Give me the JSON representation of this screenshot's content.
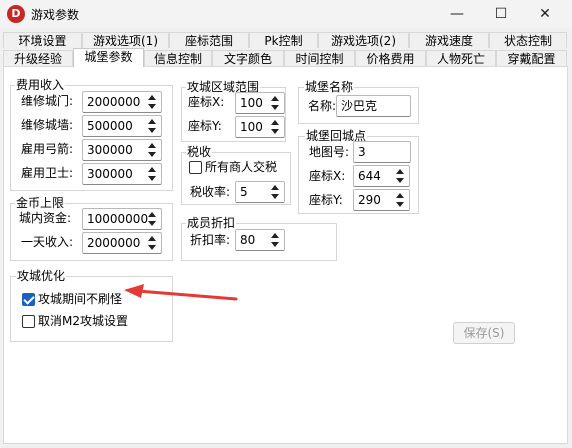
{
  "window": {
    "title": "游戏参数",
    "app_icon_letter": "D",
    "minimize_glyph": "—",
    "maximize_glyph": "☐",
    "close_glyph": "✕"
  },
  "tabs_row1": [
    "环境设置",
    "游戏选项(1)",
    "座标范围",
    "Pk控制",
    "游戏选项(2)",
    "游戏速度",
    "状态控制"
  ],
  "tabs_row2": [
    "升级经验",
    "城堡参数",
    "信息控制",
    "文字颜色",
    "时间控制",
    "价格费用",
    "人物死亡",
    "穿戴配置"
  ],
  "active_tab": "城堡参数",
  "fees": {
    "title": "费用收入",
    "fields": [
      {
        "label": "维修城门:",
        "value": "2000000"
      },
      {
        "label": "维修城墙:",
        "value": "500000"
      },
      {
        "label": "雇用弓箭:",
        "value": "300000"
      },
      {
        "label": "雇用卫士:",
        "value": "300000"
      }
    ]
  },
  "gold_limit": {
    "title": "金币上限",
    "fields": [
      {
        "label": "城内资金:",
        "value": "10000000"
      },
      {
        "label": "一天收入:",
        "value": "2000000"
      }
    ]
  },
  "siege_opt": {
    "title": "攻城优化",
    "options": [
      {
        "label": "攻城期间不刷怪",
        "checked": true
      },
      {
        "label": "取消M2攻城设置",
        "checked": false
      }
    ]
  },
  "siege_area": {
    "title": "攻城区域范围",
    "fields": [
      {
        "label": "座标X:",
        "value": "100"
      },
      {
        "label": "座标Y:",
        "value": "100"
      }
    ]
  },
  "tax": {
    "title": "税收",
    "all_merchants_label": "所有商人交税",
    "all_merchants_checked": false,
    "rate_label": "税收率:",
    "rate_value": "5"
  },
  "member_discount": {
    "title": "成员折扣",
    "label": "折扣率:",
    "value": "80"
  },
  "castle_name": {
    "title": "城堡名称",
    "label": "名称:",
    "value": "沙巴克"
  },
  "castle_return": {
    "title": "城堡回城点",
    "fields": [
      {
        "label": "地图号:",
        "value": "3"
      },
      {
        "label": "座标X:",
        "value": "644"
      },
      {
        "label": "座标Y:",
        "value": "290"
      }
    ]
  },
  "save_button": "保存(S)",
  "colors": {
    "arrow": "#e53935",
    "check_accent": "#1e5fc4",
    "app_icon": "#c62828"
  }
}
